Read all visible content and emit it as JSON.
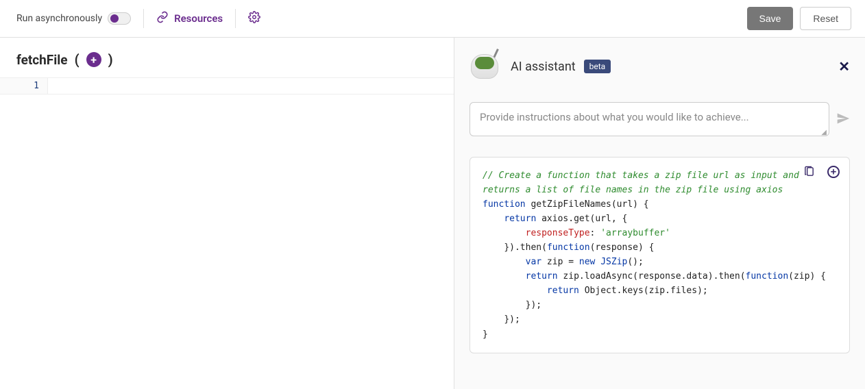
{
  "toolbar": {
    "async_label": "Run asynchronously",
    "resources_label": "Resources",
    "save_label": "Save",
    "reset_label": "Reset"
  },
  "editor": {
    "function_name": "fetchFile",
    "line_numbers": [
      "1"
    ],
    "code": ""
  },
  "assistant": {
    "title": "AI assistant",
    "badge": "beta",
    "prompt_placeholder": "Provide instructions about what you would like to achieve...",
    "code": {
      "comment": "// Create a function that takes a zip file url as input and returns a list of file names in the zip file using axios",
      "fn_kw": "function",
      "fn_sig": " getZipFileNames(url) {",
      "l_ret1": "return",
      "l_ret1_rest": " axios.get(url, {",
      "l_prop": "responseType",
      "l_colon": ": ",
      "l_str": "'arraybuffer'",
      "l_close1": "}).then(",
      "l_fn2": "function",
      "l_fn2_rest": "(response) {",
      "l_var": "var",
      "l_var_rest": " zip = ",
      "l_new": "new",
      "l_type": " JSZip",
      "l_type_rest": "();",
      "l_ret2": "return",
      "l_ret2_rest": " zip.loadAsync(response.data).then(",
      "l_fn3": "function",
      "l_fn3_rest": "(zip) {",
      "l_ret3": "return",
      "l_ret3_rest": " Object.keys(zip.files);",
      "l_close_inner": "});",
      "l_close_outer": "});",
      "l_close_fn": "}"
    }
  }
}
